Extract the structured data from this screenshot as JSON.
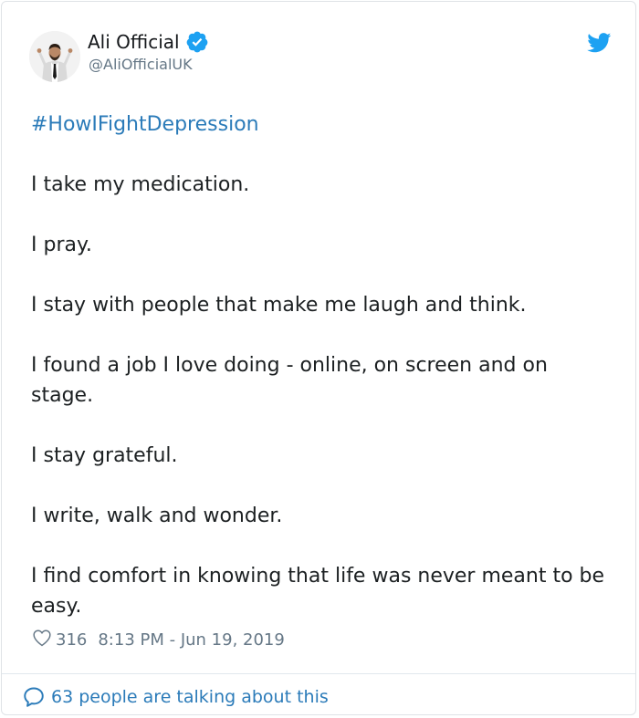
{
  "author": {
    "name": "Ali Official",
    "handle": "@AliOfficialUK",
    "verified": true,
    "avatar_icon": "person-avatar"
  },
  "tweet": {
    "hashtag": "#HowIFightDepression",
    "paragraphs": [
      "I take my medication.",
      "I pray.",
      "I stay with people that make me laugh and think.",
      "I found a job I love doing - online, on screen and on stage.",
      "I stay grateful.",
      "I write, walk and wonder.",
      "I find comfort in knowing that life was never meant to be easy."
    ],
    "likes": "316",
    "timestamp": "8:13 PM - Jun 19, 2019"
  },
  "footer": {
    "talking_text": "63 people are talking about this"
  },
  "colors": {
    "link": "#2b7bb9",
    "text": "#1c2022",
    "muted": "#657786",
    "verified": "#1da1f2",
    "twitter_blue": "#1da1f2"
  },
  "icons": {
    "verified": "verified-badge-icon",
    "brand": "twitter-bird-icon",
    "like": "heart-icon",
    "reply": "speech-bubble-icon"
  }
}
